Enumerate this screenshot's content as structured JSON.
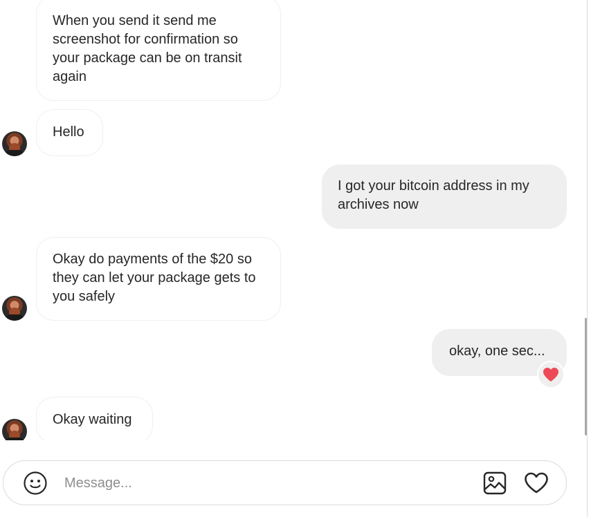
{
  "messages": [
    {
      "direction": "incoming",
      "text": "When you send it send me screenshot for confirmation so your package can be on transit again"
    },
    {
      "direction": "incoming",
      "text": "Hello"
    },
    {
      "direction": "outgoing",
      "text": "I got your bitcoin address in my archives now"
    },
    {
      "direction": "incoming",
      "text": "Okay do payments of the $20 so they can let your package gets to you safely"
    },
    {
      "direction": "outgoing",
      "text": "okay, one sec...",
      "reaction": "heart-icon"
    },
    {
      "direction": "incoming",
      "text": "Okay waiting"
    }
  ],
  "composer": {
    "placeholder": "Message...",
    "value": ""
  },
  "colors": {
    "reaction_heart": "#ed4956",
    "outgoing_bubble": "#efefef",
    "incoming_border": "#efefef",
    "text": "#262626",
    "placeholder": "#8e8e8e"
  },
  "icons": {
    "emoji": "smiley-face-icon",
    "image": "image-icon",
    "like": "heart-outline-icon"
  }
}
